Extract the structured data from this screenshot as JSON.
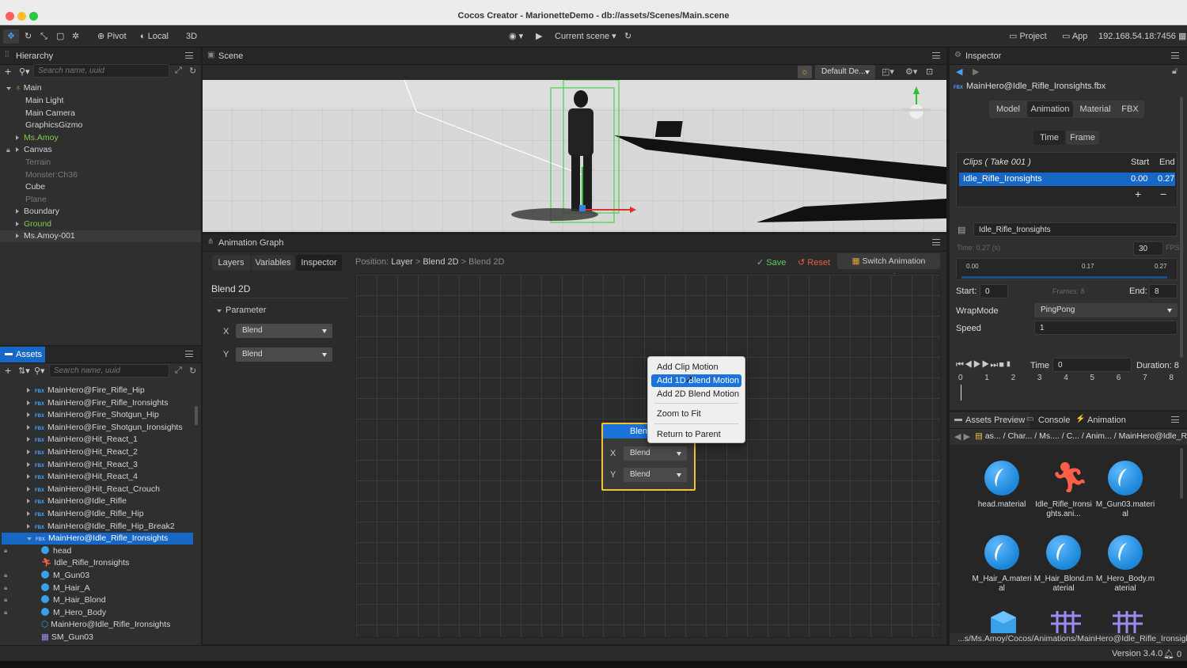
{
  "window": {
    "title": "Cocos Creator - MarionetteDemo - db://assets/Scenes/Main.scene"
  },
  "toolbar": {
    "pivot": "Pivot",
    "local": "Local",
    "mode_3d": "3D",
    "scene_select": "Current scene",
    "project": "Project",
    "app": "App",
    "ip": "192.168.54.18:7456"
  },
  "hierarchy": {
    "tab": "Hierarchy",
    "search_placeholder": "Search name, uuid",
    "items": [
      "Main",
      "Main Light",
      "Main Camera",
      "GraphicsGizmo",
      "Ms.Amoy",
      "Canvas",
      "Terrain",
      "Monster:Ch36",
      "Cube",
      "Plane",
      "Boundary",
      "Ground",
      "Ms.Amoy-001"
    ]
  },
  "assets": {
    "tab": "Assets",
    "search_placeholder": "Search name, uuid",
    "items": [
      "MainHero@Fire_Rifle_Hip",
      "MainHero@Fire_Rifle_Ironsights",
      "MainHero@Fire_Shotgun_Hip",
      "MainHero@Fire_Shotgun_Ironsights",
      "MainHero@Hit_React_1",
      "MainHero@Hit_React_2",
      "MainHero@Hit_React_3",
      "MainHero@Hit_React_4",
      "MainHero@Hit_React_Crouch",
      "MainHero@Idle_Rifle",
      "MainHero@Idle_Rifle_Hip",
      "MainHero@Idle_Rifle_Hip_Break2",
      "MainHero@Idle_Rifle_Ironsights"
    ],
    "children": [
      "head",
      "Idle_Rifle_Ironsights",
      "M_Gun03",
      "M_Hair_A",
      "M_Hair_Blond",
      "M_Hero_Body",
      "MainHero@Idle_Rifle_Ironsights",
      "SM_Gun03"
    ]
  },
  "scene": {
    "tab": "Scene",
    "camera_select": "Default De..."
  },
  "animation_graph": {
    "tab": "Animation Graph",
    "subtabs": [
      "Layers",
      "Variables",
      "Inspector"
    ],
    "position_label": "Position:",
    "breadcrumb": [
      "Layer",
      "Blend 2D",
      "Blend 2D"
    ],
    "save": "Save",
    "reset": "Reset",
    "switch": "Switch Animation Graphs",
    "heading": "Blend 2D",
    "parameter": "Parameter",
    "x_label": "X",
    "y_label": "Y",
    "x_value": "Blend",
    "y_value": "Blend",
    "node": {
      "title": "Blen",
      "x_label": "X",
      "y_label": "Y",
      "x_value": "Blend",
      "y_value": "Blend"
    },
    "context_menu": [
      "Add Clip Motion",
      "Add 1D Blend Motion",
      "Add 2D Blend Motion",
      "Zoom to Fit",
      "Return to Parent"
    ]
  },
  "inspector": {
    "tab": "Inspector",
    "file": "MainHero@Idle_Rifle_Ironsights.fbx",
    "tabs": [
      "Model",
      "Animation",
      "Material",
      "FBX"
    ],
    "time_tabs": [
      "Time",
      "Frame"
    ],
    "clips_header": "Clips ( Take 001 )",
    "start_header": "Start",
    "end_header": "End",
    "clip_name": "Idle_Rifle_Ironsights",
    "clip_start": "0.00",
    "clip_end": "0.27",
    "clip_name_field": "Idle_Rifle_Ironsights",
    "time_label": "Time: 0.27 (s)",
    "fps_value": "30",
    "fps_label": "FPS",
    "ruler": [
      "0.00",
      "0.17",
      "0.27"
    ],
    "start_label": "Start:",
    "start_value": "0",
    "frames_label": "Frames: 8",
    "end_label": "End:",
    "end_value": "8",
    "wrapmode_label": "WrapMode",
    "wrapmode_value": "PingPong",
    "speed_label": "Speed",
    "speed_value": "1",
    "time2_label": "Time",
    "time2_value": "0",
    "duration": "Duration: 8",
    "frame_ticks": [
      "0",
      "1",
      "2",
      "3",
      "4",
      "5",
      "6",
      "7",
      "8"
    ]
  },
  "preview": {
    "tabs": [
      "Assets Preview",
      "Console",
      "Animation"
    ],
    "path": [
      "as...",
      "Char...",
      "Ms....",
      "C...",
      "Anim...",
      "MainHero@Idle_Rif..."
    ],
    "items": [
      {
        "name": "head.material",
        "icon": "material-icon"
      },
      {
        "name": "Idle_Rifle_Ironsights.ani...",
        "icon": "animation-clip-icon"
      },
      {
        "name": "M_Gun03.material",
        "icon": "material-icon"
      },
      {
        "name": "M_Hair_A.material",
        "icon": "material-icon"
      },
      {
        "name": "M_Hair_Blond.material",
        "icon": "material-icon"
      },
      {
        "name": "M_Hero_Body.material",
        "icon": "material-icon"
      }
    ],
    "footer_path": "...s/Ms.Amoy/Cocos/Animations/MainHero@Idle_Rifle_Ironsights"
  },
  "status": {
    "version": "Version 3.4.0",
    "notifications": "0"
  }
}
